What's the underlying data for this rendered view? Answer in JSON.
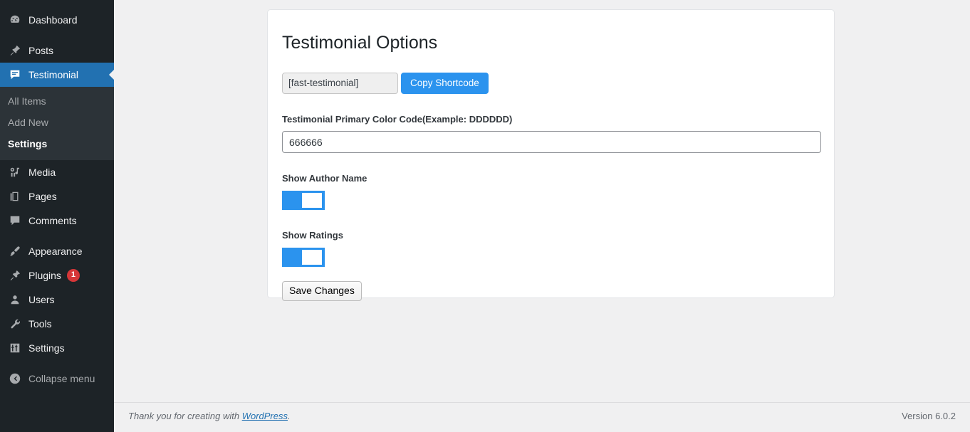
{
  "sidebar": {
    "items": [
      {
        "label": "Dashboard",
        "icon": "dashboard-icon",
        "current": false
      },
      {
        "label": "Posts",
        "icon": "pin-icon",
        "current": false
      },
      {
        "label": "Testimonial",
        "icon": "speech-bubble-icon",
        "current": true
      },
      {
        "label": "Media",
        "icon": "media-icon",
        "current": false
      },
      {
        "label": "Pages",
        "icon": "pages-icon",
        "current": false
      },
      {
        "label": "Comments",
        "icon": "comment-icon",
        "current": false
      },
      {
        "label": "Appearance",
        "icon": "paintbrush-icon",
        "current": false
      },
      {
        "label": "Plugins",
        "icon": "plug-icon",
        "current": false,
        "badge": "1"
      },
      {
        "label": "Users",
        "icon": "user-icon",
        "current": false
      },
      {
        "label": "Tools",
        "icon": "wrench-icon",
        "current": false
      },
      {
        "label": "Settings",
        "icon": "sliders-icon",
        "current": false
      }
    ],
    "submenu": [
      {
        "label": "All Items",
        "current": false
      },
      {
        "label": "Add New",
        "current": false
      },
      {
        "label": "Settings",
        "current": true
      }
    ],
    "collapse": {
      "label": "Collapse menu",
      "icon": "collapse-arrow-icon"
    },
    "badge_color": "#d63638",
    "current_color": "#2271b1"
  },
  "main": {
    "title": "Testimonial Options",
    "shortcode": {
      "value": "[fast-testimonial]",
      "placeholder": "[fast-testimonial]",
      "copy_label": "Copy Shortcode"
    },
    "color_field": {
      "label": "Testimonial Primary Color Code(Example: DDDDDD)",
      "value": "666666",
      "placeholder": "DDDDDD"
    },
    "show_author": {
      "label": "Show Author Name",
      "state": "on"
    },
    "show_ratings": {
      "label": "Show Ratings",
      "state": "on"
    },
    "save_label": "Save Changes",
    "accent_color": "#2b93ee"
  },
  "footer": {
    "thanks_prefix": "Thank you for creating with ",
    "link_label": "WordPress",
    "thanks_suffix": ".",
    "version": "Version 6.0.2"
  }
}
